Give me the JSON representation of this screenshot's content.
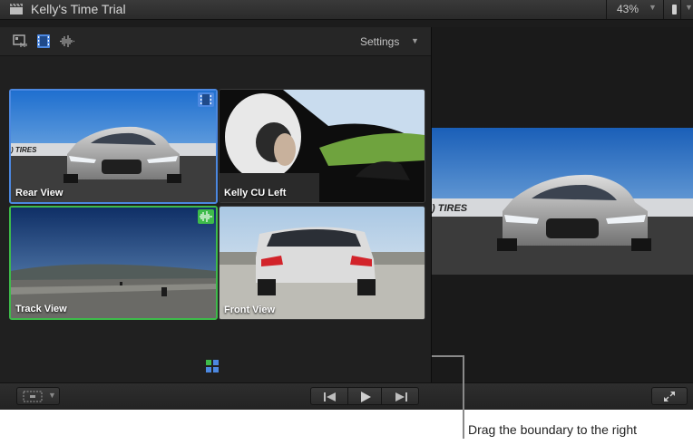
{
  "window": {
    "title": "Kelly's Time Trial",
    "zoom": "43%"
  },
  "angle_viewer": {
    "settings_label": "Settings",
    "toolbar_icons": [
      "switch-video-audio-icon",
      "film-strip-icon",
      "audio-waveform-icon"
    ],
    "angles": [
      {
        "label": "Rear View",
        "state": "active-video",
        "badge": "film-strip-icon"
      },
      {
        "label": "Kelly CU Left",
        "state": "inactive"
      },
      {
        "label": "Track View",
        "state": "active-audio",
        "badge": "audio-waveform-icon"
      },
      {
        "label": "Front View",
        "state": "inactive"
      }
    ]
  },
  "playback": {
    "buttons": [
      "previous-angle-icon",
      "play-icon",
      "next-angle-icon"
    ]
  },
  "callout": {
    "text": "Drag the boundary to the right"
  },
  "colors": {
    "video_highlight": "#4c88e0",
    "audio_highlight": "#3ebb4a",
    "background": "#1c1c1c"
  }
}
